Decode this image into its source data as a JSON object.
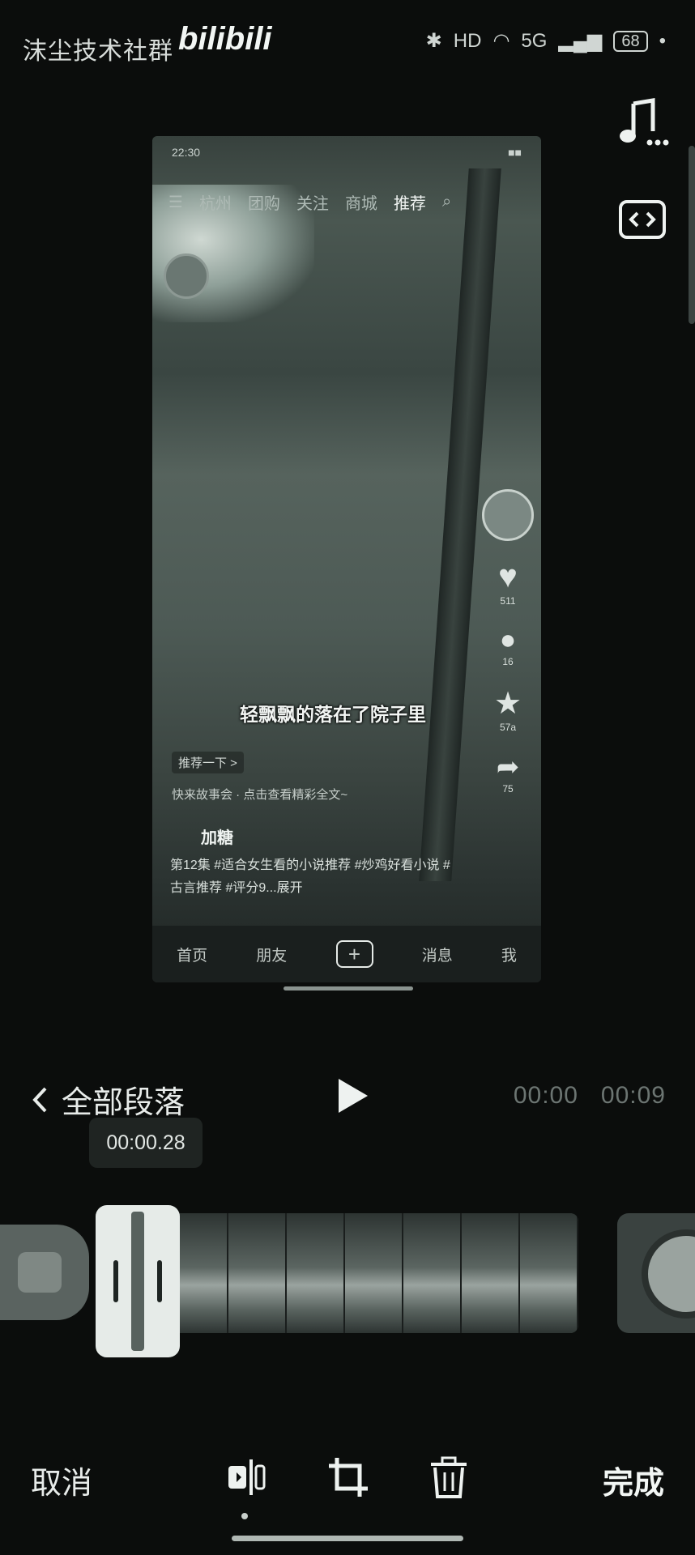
{
  "status_bar": {
    "watermark": "沫尘技术社群",
    "logo": "bilibili",
    "hd": "HD",
    "network": "5G",
    "battery": "68"
  },
  "tools": {
    "music_icon": "music-note-icon",
    "embed_icon": "code-brackets-icon"
  },
  "preview": {
    "status_time": "22:30",
    "nav": [
      "杭州",
      "团购",
      "关注",
      "商城",
      "推荐"
    ],
    "side": {
      "likes": "511",
      "comments": "16",
      "favorites": "57a",
      "shares": "75"
    },
    "subtitle": "轻飘飘的落在了院子里",
    "recommend": "推荐一下 >",
    "link": "快来故事会 · 点击查看精彩全文~",
    "author": "加糖",
    "description": "第12集 #适合女生看的小说推荐 #炒鸡好看小说 #古言推荐 #评分9...展开",
    "tabs": [
      "首页",
      "朋友",
      "+",
      "消息",
      "我"
    ]
  },
  "controls": {
    "back_label": "全部段落",
    "time_start": "00:00",
    "time_end": "00:09",
    "current_time": "00:00.28"
  },
  "bottom": {
    "cancel": "取消",
    "done": "完成"
  }
}
